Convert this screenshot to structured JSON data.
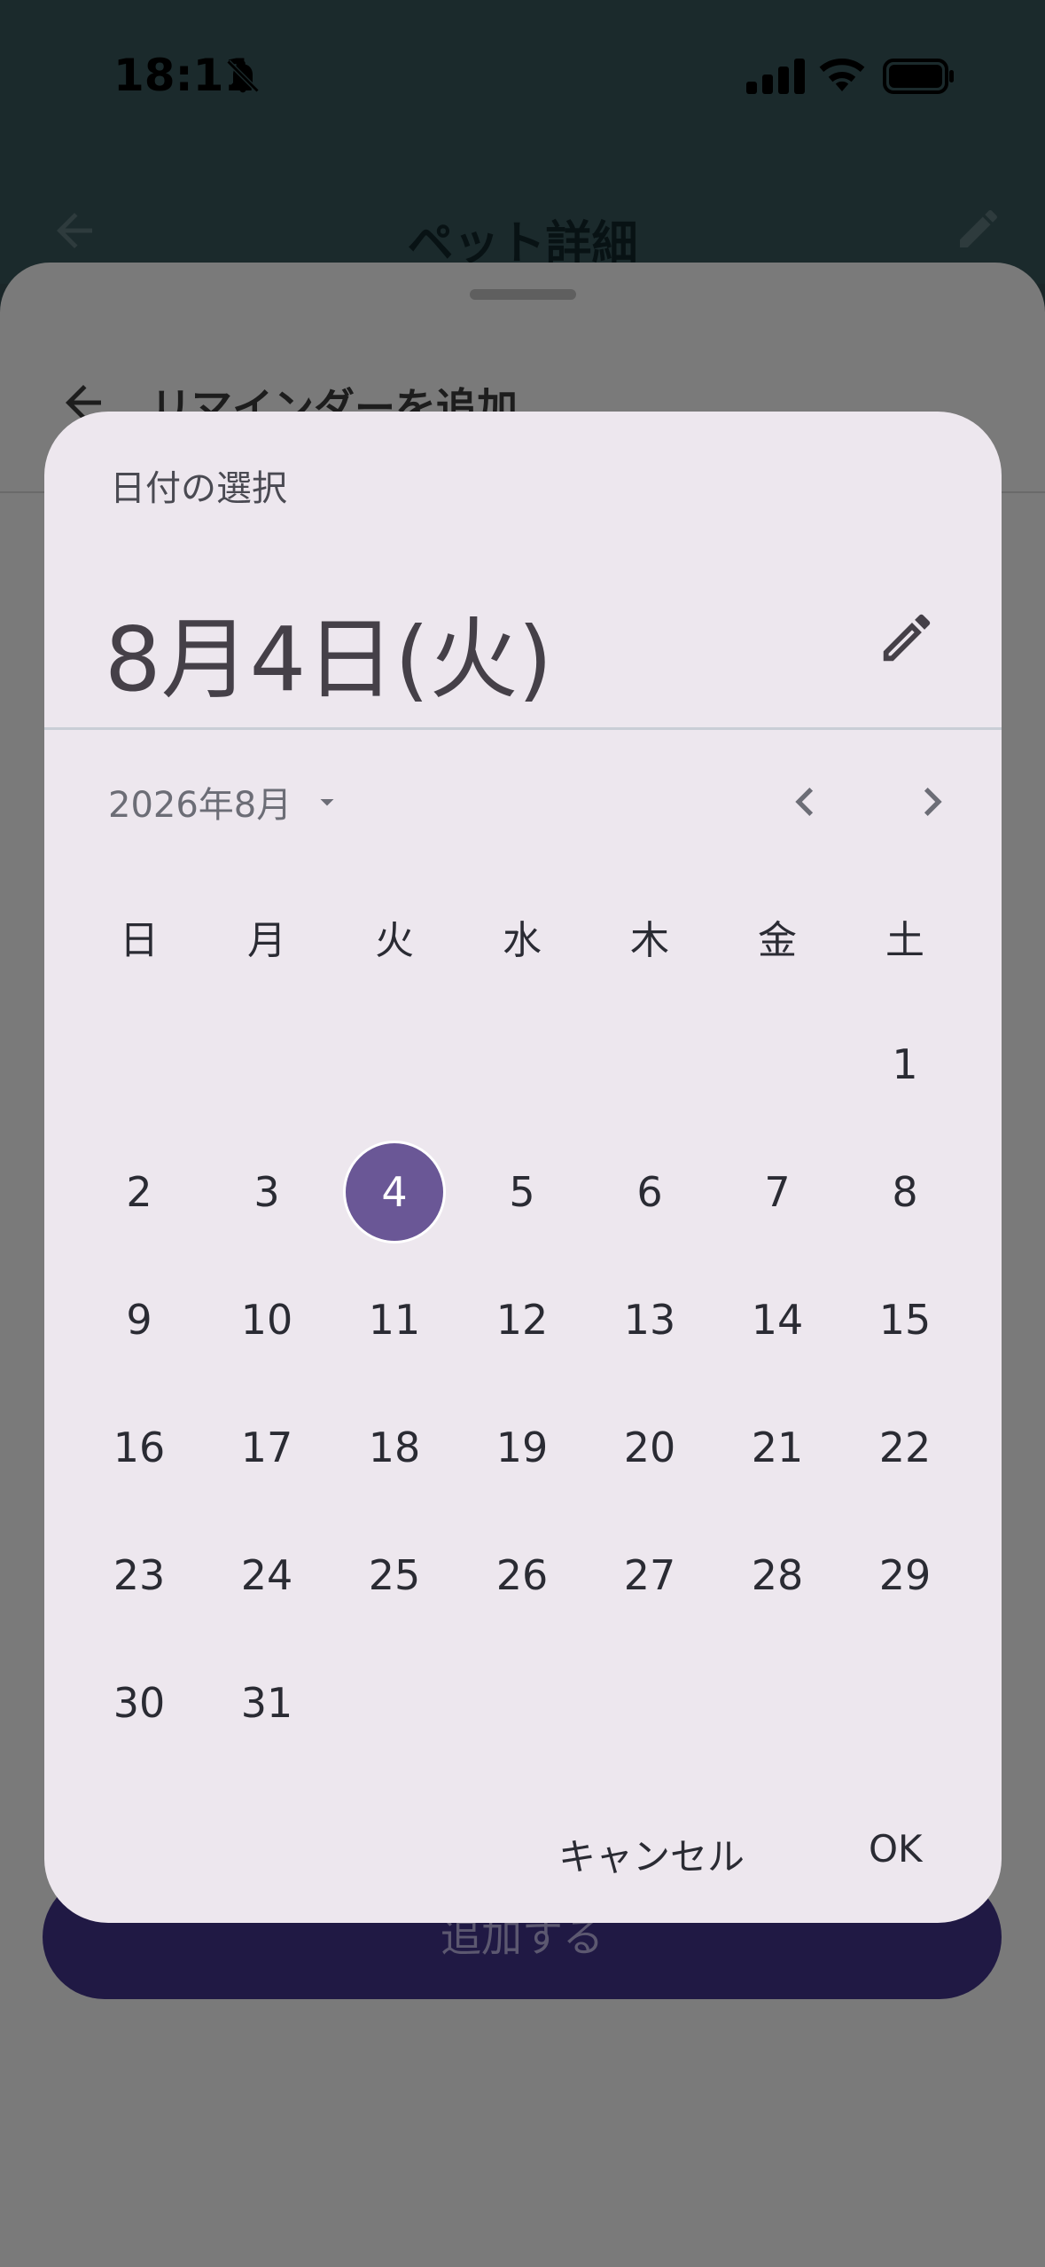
{
  "status_bar": {
    "time": "18:11"
  },
  "app_bar": {
    "title": "ペット詳細"
  },
  "sheet": {
    "title": "リマインダーを追加",
    "add_button": "追加する"
  },
  "date_picker": {
    "label": "日付の選択",
    "selected_date": "8月4日(火)",
    "month_label": "2026年8月",
    "weekdays": [
      "日",
      "月",
      "火",
      "水",
      "木",
      "金",
      "土"
    ],
    "first_day_column": 6,
    "days": [
      "1",
      "2",
      "3",
      "4",
      "5",
      "6",
      "7",
      "8",
      "9",
      "10",
      "11",
      "12",
      "13",
      "14",
      "15",
      "16",
      "17",
      "18",
      "19",
      "20",
      "21",
      "22",
      "23",
      "24",
      "25",
      "26",
      "27",
      "28",
      "29",
      "30",
      "31"
    ],
    "selected_day": "4",
    "cancel_label": "キャンセル",
    "ok_label": "OK"
  },
  "colors": {
    "selected_day": "#6a5796",
    "dialog_background": "#ede7ee",
    "scrim": "#7a7a7a",
    "primary_button": "#201944"
  }
}
